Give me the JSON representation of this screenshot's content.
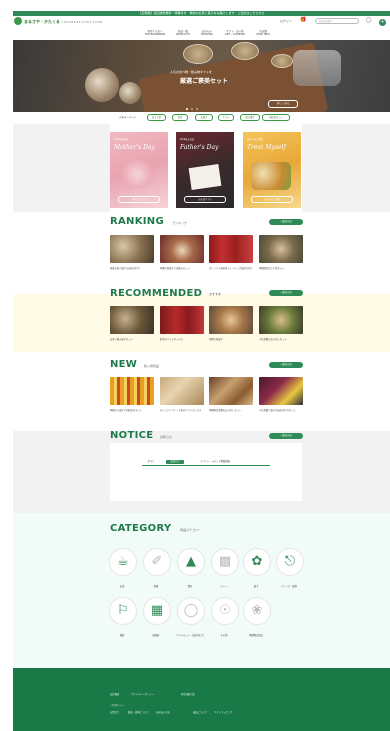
{
  "topbar": {
    "text": "【定期便】初回送料無料・特典付き　季節のお茶と菓子をお届けします　ご注文はこちらから"
  },
  "header": {
    "logo_text": "まるさや・かたくる",
    "logo_sub": "ＪＡＰＡＮＥＳＥ ＣＨＡＩ ＦＯＯＤ",
    "nav": [
      {
        "label": "初めての方へ\nFOR BEGINNERS"
      },
      {
        "label": "商品一覧\nPRODUCTS"
      },
      {
        "label": "読みもの\nREADING"
      },
      {
        "label": "ギフト・法人様\nGIFT・COMPANY"
      },
      {
        "label": "実店舗\nSHOP INFO"
      }
    ],
    "login": "ログイン",
    "search_placeholder": "商品を検索",
    "cart_count": "0"
  },
  "hero": {
    "line1": "人気の食べ物・飲み物ギフトを",
    "line2": "厳選ご褒美セット",
    "button": "詳しく見る"
  },
  "tags": {
    "label": "人気キーワード",
    "items": [
      "ほうじ茶",
      "紅茶",
      "お菓子",
      "ギフト",
      "焼き菓子",
      "和紅茶セット"
    ]
  },
  "promos": [
    {
      "sub": "5/12は母の日",
      "title": "Mother's Day",
      "button": "母の日ギフト"
    },
    {
      "sub": "6/16は父の日",
      "title": "Father's Day",
      "button": "父の日ギフト"
    },
    {
      "sub": "自分へのご褒美",
      "title": "Treat Myself",
      "button": "自分へのご褒美"
    }
  ],
  "ranking": {
    "title": "RANKING",
    "sub": "ランキング",
    "button": "一覧を見る",
    "items": [
      "国産お茶と菓子の詰め合わせ",
      "季節の和菓子と煎茶のセット",
      "オリジナル和紅茶ティーバッグ詰め合わせ",
      "季節限定ほうじ茶セット"
    ]
  },
  "recommended": {
    "title": "RECOMMENDED",
    "sub": "おすすめ",
    "button": "一覧を見る",
    "items": [
      "お茶と焼き菓子セット",
      "紅茶のギフトボックス",
      "季節の和菓子",
      "人気茶葉のおためしセット"
    ]
  },
  "new": {
    "title": "NEW",
    "sub": "新入荷商品",
    "button": "一覧を見る",
    "items": [
      "季節の干菓子と和紅茶のセット",
      "オリジナルブレンド茶のギフトボックス",
      "季節限定茶葉のおためしセット",
      "人気茶葉と菓子の詰め合わせセット"
    ]
  },
  "notice": {
    "title": "NOTICE",
    "sub": "お知らせ",
    "button": "一覧を見る",
    "tabs": [
      "すべて",
      "お知らせ",
      "イベント・メディア掲載情報"
    ]
  },
  "category": {
    "title": "CATEGORY",
    "sub": "商品カテゴリー",
    "items": [
      {
        "label": "お茶",
        "icon": "teacup-icon"
      },
      {
        "label": "茶器",
        "icon": "tea-ware-icon"
      },
      {
        "label": "食品",
        "icon": "food-icon"
      },
      {
        "label": "ティー",
        "icon": "tea-icon"
      },
      {
        "label": "菓子",
        "icon": "sweets-icon"
      },
      {
        "label": "ドリンク・飲料",
        "icon": "drink-icon"
      },
      {
        "label": "雑貨",
        "icon": "goods-icon"
      },
      {
        "label": "調味料",
        "icon": "seasoning-icon"
      },
      {
        "label": "ギフトセット・詰め合わせ",
        "icon": "gift-icon"
      },
      {
        "label": "その他",
        "icon": "other-icon"
      },
      {
        "label": "季節限定商品",
        "icon": "seasonal-icon"
      }
    ]
  },
  "footer": {
    "links1": [
      "会社概要",
      "プライバシーポリシー",
      "特定商取引法"
    ],
    "heading": "ご利用ガイド",
    "links2": [
      "お問合せ",
      "配送・送料について",
      "お支払い方法",
      "返品について",
      "ギフトラッピング"
    ]
  },
  "colors": {
    "brand": "#1e7a4a",
    "accent": "#2e8b57",
    "recommended_bg": "#fffbe6",
    "category_bg": "#f1fbf8"
  }
}
